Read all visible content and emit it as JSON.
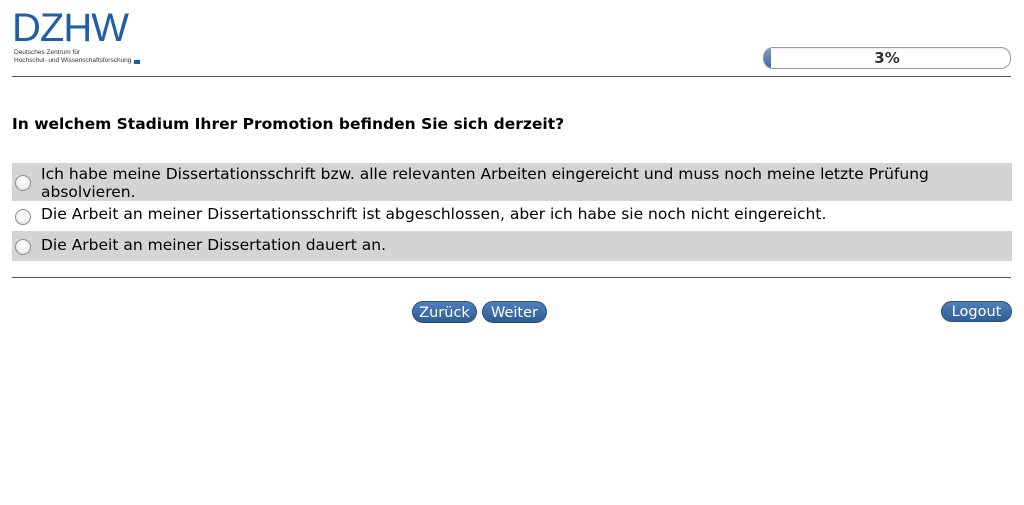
{
  "logo": {
    "wordmark": "DZHW",
    "subtitle_line1": "Deutsches Zentrum für",
    "subtitle_line2": "Hochschul- und Wissenschaftsforschung"
  },
  "progress": {
    "value": 0.03,
    "label": "3%"
  },
  "question": {
    "text": "In welchem Stadium Ihrer Promotion befinden Sie sich derzeit?"
  },
  "options": [
    {
      "label": "Ich habe meine Dissertationsschrift bzw. alle relevanten Arbeiten eingereicht und muss noch meine letzte Prüfung absolvieren.",
      "selected": false
    },
    {
      "label": "Die Arbeit an meiner Dissertationsschrift ist abgeschlossen, aber ich habe sie noch nicht eingereicht.",
      "selected": false
    },
    {
      "label": "Die Arbeit an meiner Dissertation dauert an.",
      "selected": false
    }
  ],
  "nav": {
    "back_label": "Zurück",
    "next_label": "Weiter",
    "logout_label": "Logout"
  },
  "colors": {
    "brand_blue": "#1f5fa8",
    "button_blue": "#3a6aa3",
    "row_shade": "#d4d4d4"
  }
}
